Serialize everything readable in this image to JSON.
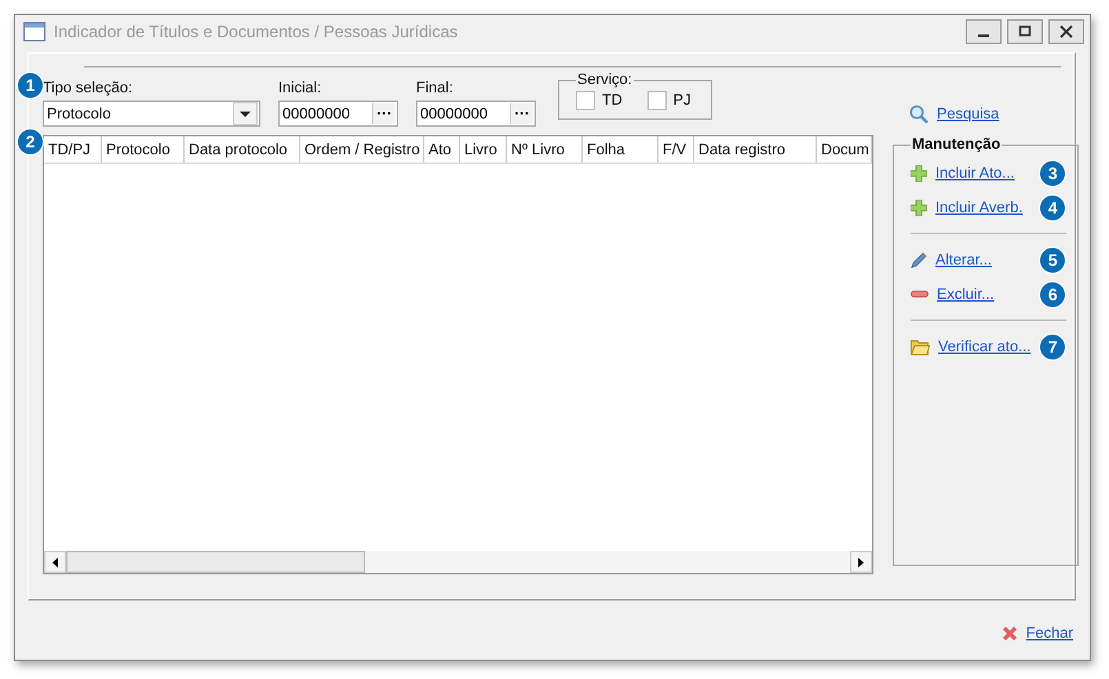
{
  "window": {
    "title": "Indicador de Títulos e Documentos / Pessoas Jurídicas"
  },
  "filters": {
    "tipo_label": "Tipo seleção:",
    "tipo_value": "Protocolo",
    "inicial_label": "Inicial:",
    "inicial_value": "00000000",
    "final_label": "Final:",
    "final_value": "00000000",
    "browse": "···",
    "servico": {
      "label": "Serviço:",
      "options": [
        {
          "label": "TD",
          "checked": false
        },
        {
          "label": "PJ",
          "checked": false
        }
      ]
    }
  },
  "search_link": "Pesquisa",
  "table": {
    "columns": [
      {
        "label": "TD/PJ"
      },
      {
        "label": "Protocolo"
      },
      {
        "label": "Data protocolo"
      },
      {
        "label": "Ordem / Registro"
      },
      {
        "label": "Ato"
      },
      {
        "label": "Livro"
      },
      {
        "label": "Nº Livro"
      },
      {
        "label": "Folha"
      },
      {
        "label": "F/V"
      },
      {
        "label": "Data registro"
      },
      {
        "label": "Docum"
      }
    ]
  },
  "manutencao": {
    "title": "Manutenção",
    "groups": [
      [
        {
          "label": "Incluir Ato...",
          "kind": "add",
          "badge": "3"
        },
        {
          "label": "Incluir Averb.",
          "kind": "add",
          "badge": "4"
        }
      ],
      [
        {
          "label": "Alterar...",
          "kind": "edit",
          "badge": "5"
        },
        {
          "label": "Excluir...",
          "kind": "delete",
          "badge": "6"
        }
      ],
      [
        {
          "label": "Verificar ato...",
          "kind": "open",
          "badge": "7"
        }
      ]
    ]
  },
  "badges": [
    "1",
    "2"
  ],
  "close_link": "Fechar"
}
